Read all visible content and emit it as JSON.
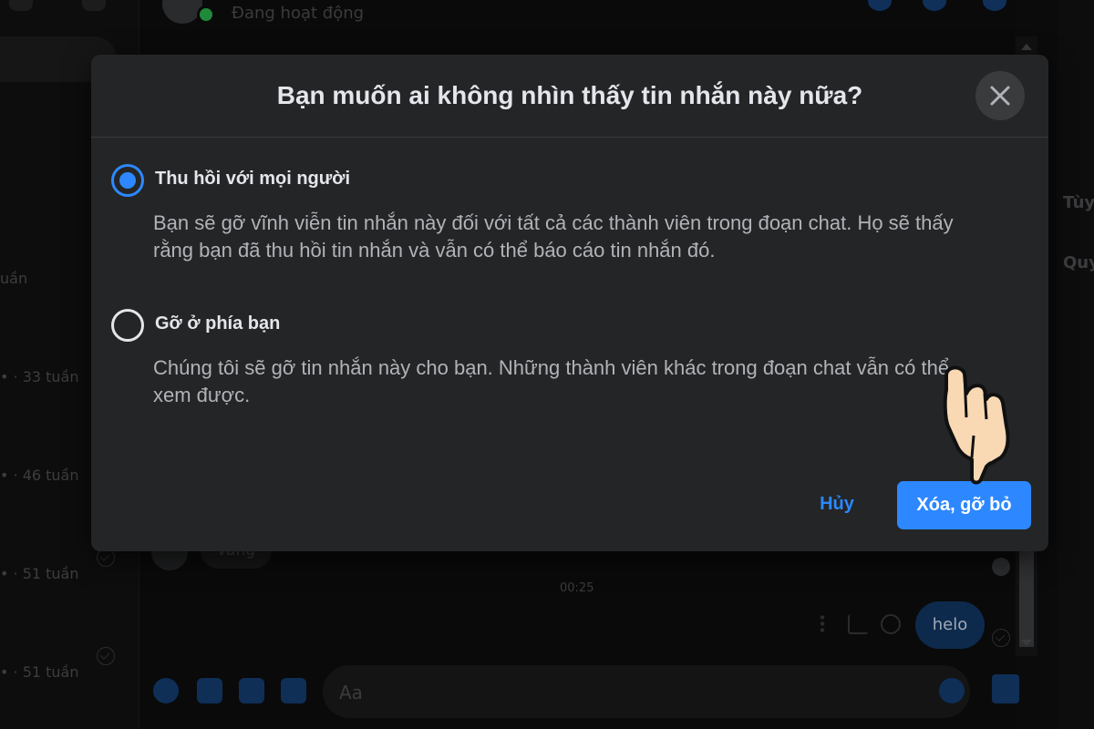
{
  "background": {
    "chat_header": {
      "status": "Đang hoạt động"
    },
    "conversation_list": {
      "items": [
        {
          "time": "uần"
        },
        {
          "time": "• · 33 tuần"
        },
        {
          "time": "• · 46 tuần"
        },
        {
          "time": "• · 51 tuần"
        },
        {
          "time": "• · 51 tuần"
        }
      ]
    },
    "right_panel": {
      "items": [
        "Tùy",
        "Quy"
      ]
    },
    "messages": {
      "incoming_text": "vâng",
      "timestamp": "00:25",
      "outgoing_text": "helo"
    },
    "composer": {
      "placeholder": "Aa"
    }
  },
  "dialog": {
    "title": "Bạn muốn ai không nhìn thấy tin nhắn này nữa?",
    "close_icon": "close-icon",
    "options": [
      {
        "label": "Thu hồi với mọi người",
        "description": "Bạn sẽ gỡ vĩnh viễn tin nhắn này đối với tất cả các thành viên trong đoạn chat. Họ sẽ thấy rằng bạn đã thu hồi tin nhắn và vẫn có thể báo cáo tin nhắn đó.",
        "selected": true
      },
      {
        "label": "Gỡ ở phía bạn",
        "description": "Chúng tôi sẽ gỡ tin nhắn này cho bạn. Những thành viên khác trong đoạn chat vẫn có thể xem được.",
        "selected": false
      }
    ],
    "cancel_label": "Hủy",
    "confirm_label": "Xóa, gỡ bỏ"
  },
  "colors": {
    "accent": "#2d88ff",
    "dialog_bg": "#242526",
    "text_primary": "#e4e6eb",
    "text_secondary": "#b0b3b8"
  },
  "overlay_icon": "hand-pointer-icon"
}
